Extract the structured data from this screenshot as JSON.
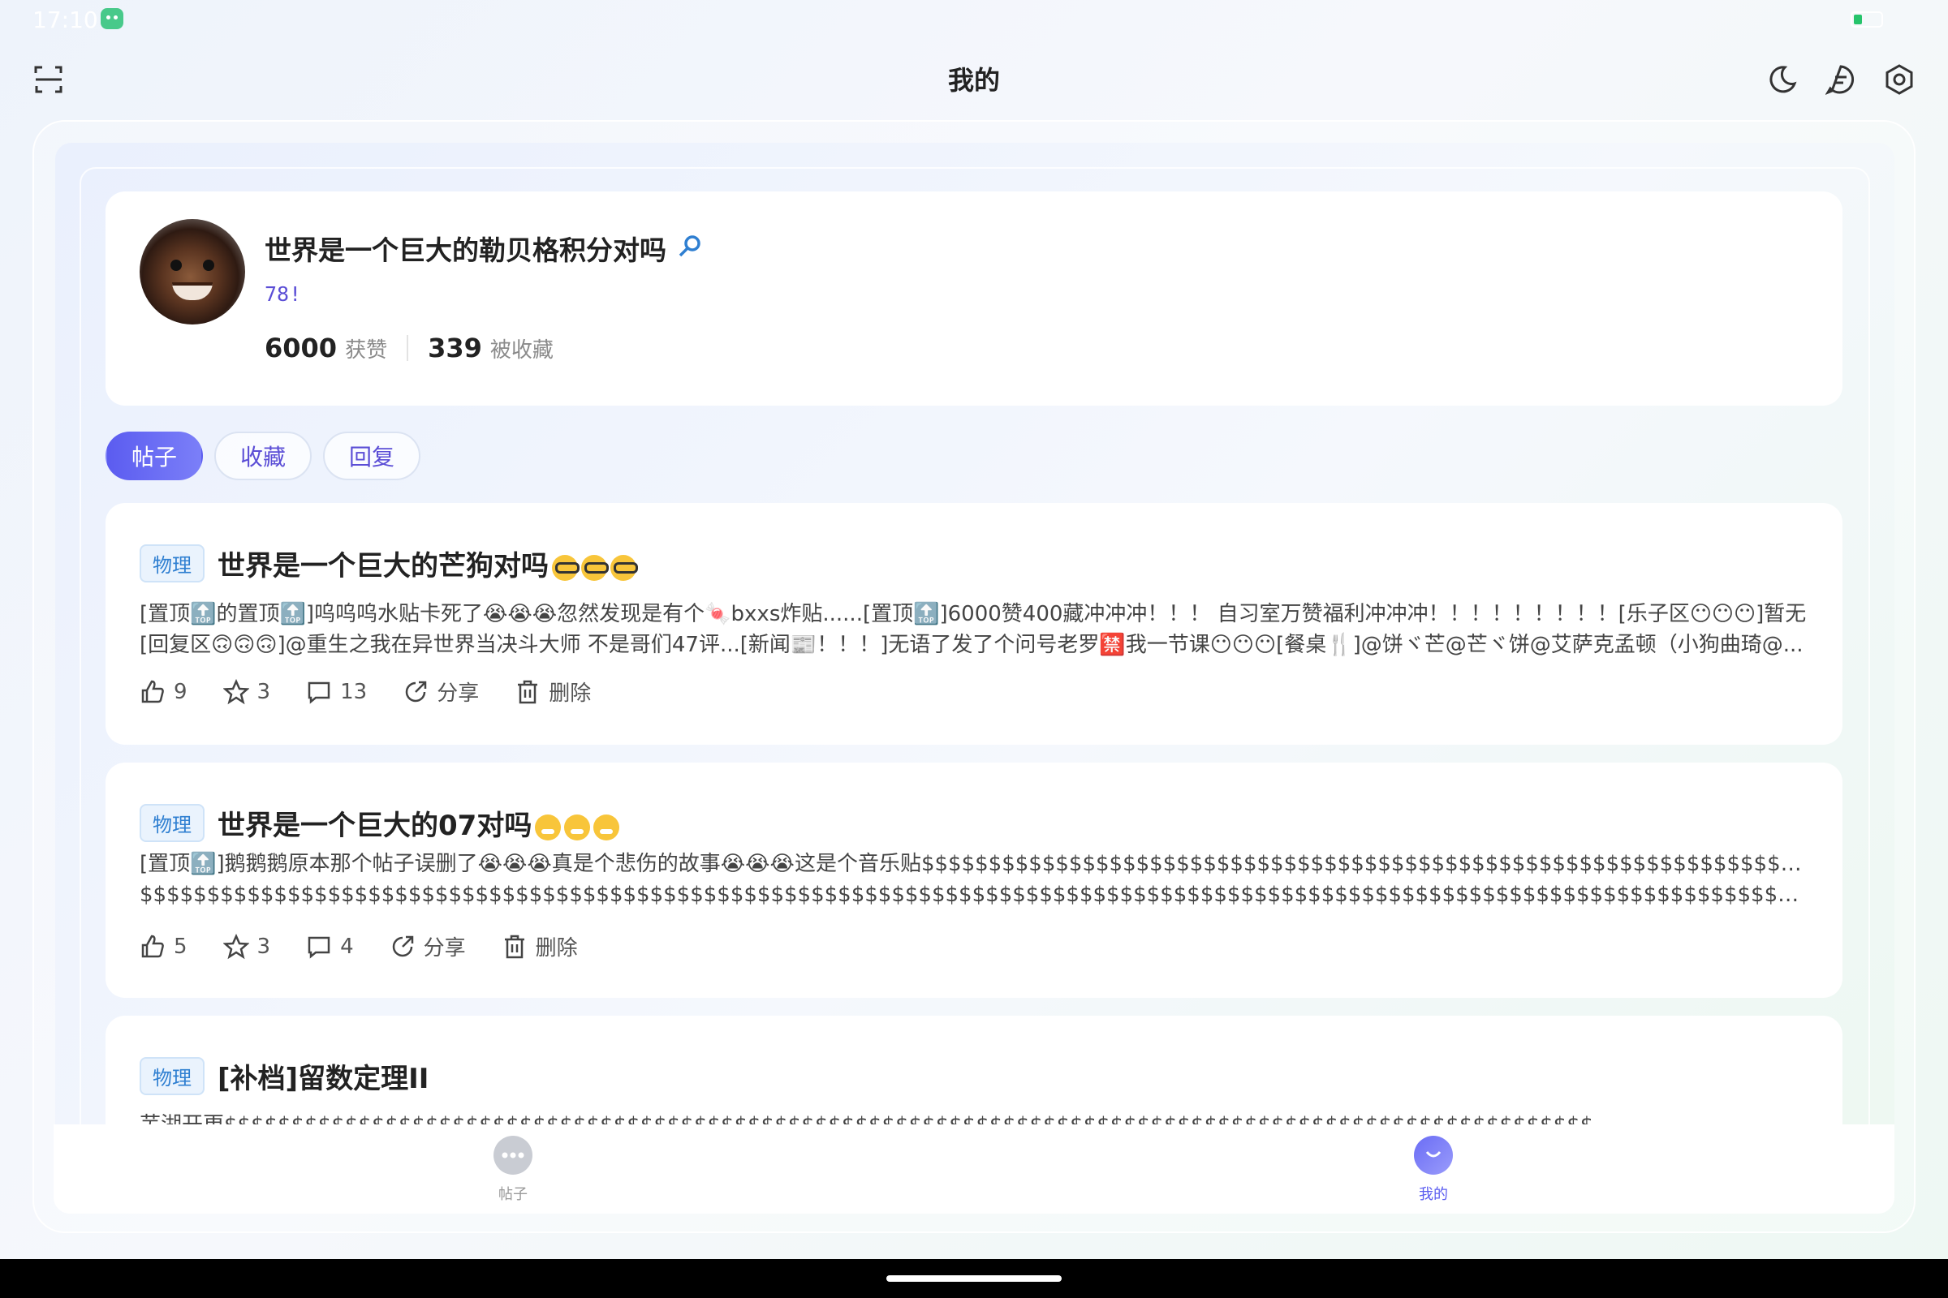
{
  "status_bar": {
    "time": "17:10"
  },
  "header": {
    "title": "我的"
  },
  "profile": {
    "name": "世界是一个巨大的勒贝格积分对吗",
    "signature": "78!",
    "likes_count": "6000",
    "likes_label": "获赞",
    "collected_count": "339",
    "collected_label": "被收藏"
  },
  "tabs": [
    "帖子",
    "收藏",
    "回复"
  ],
  "posts": [
    {
      "category": "物理",
      "title": "世界是一个巨大的芒狗对吗",
      "title_emoji": "nerd",
      "body_line1": "[置顶🔝的置顶🔝]呜呜呜水贴卡死了😭😭😭忽然发现是有个🍬bxxs炸贴......[置顶🔝]6000赞400藏冲冲冲！！！ 自习室万赞福利冲冲冲！！！！！！！！！[乐子区😶😶😶]暂无",
      "body_line2": "[回复区🙃🙃🙃]@重生之我在异世界当决斗大师 不是哥们47评...[新闻📰！！！]无语了发了个问号老罗🈲我一节课😶😶😶[餐桌🍴]@饼ヾ芒@芒ヾ饼@艾萨克孟顿（小狗曲琦@...",
      "likes": "9",
      "stars": "3",
      "comments": "13",
      "share_label": "分享",
      "delete_label": "删除"
    },
    {
      "category": "物理",
      "title": "世界是一个巨大的07对吗",
      "title_emoji": "sick",
      "body_line1": "[置顶🔝]鹅鹅鹅原本那个帖子误删了😭😭😭真是个悲伤的故事😭😭😭这是个音乐贴$$$$$$$$$$$$$$$$$$$$$$$$$$$$$$$$$$$$$$$$$$$$$$$$$$$$$$$$$$$$$$$$$$$$$$$$$$$$$$",
      "body_line2": "$$$$$$$$$$$$$$$$$$$$$$$$$$$$$$$$$$$$$$$$$$$$$$$$$$$$$$$$$$$$$$$$$$$$$$$$$$$$$$$$$$$$$$$$$$$$$$$$$$$$$$$$$$$$$$$$$$$$$$$$$$$...",
      "likes": "5",
      "stars": "3",
      "comments": "4",
      "share_label": "分享",
      "delete_label": "删除"
    },
    {
      "category": "物理",
      "title": "[补档]留数定理II",
      "body_line1": "芜湖开更$$$$$$$$$$$$$$$$$$$$$$$$$$$$$$$$$$$$$$$$$$$$$$$$$$$$$$$$$$$$$$$$$$$$$$$$$$$$$$$$$$$$$$$$$$$$$$$$$$$$$$"
    }
  ],
  "bottom_nav": [
    {
      "label": "帖子",
      "icon": "chat-bubble-icon",
      "active": false
    },
    {
      "label": "我的",
      "icon": "profile-smile-icon",
      "active": true
    }
  ],
  "colors": {
    "accent": "#5b5cf0",
    "tag_blue": "#2f7fd1"
  }
}
